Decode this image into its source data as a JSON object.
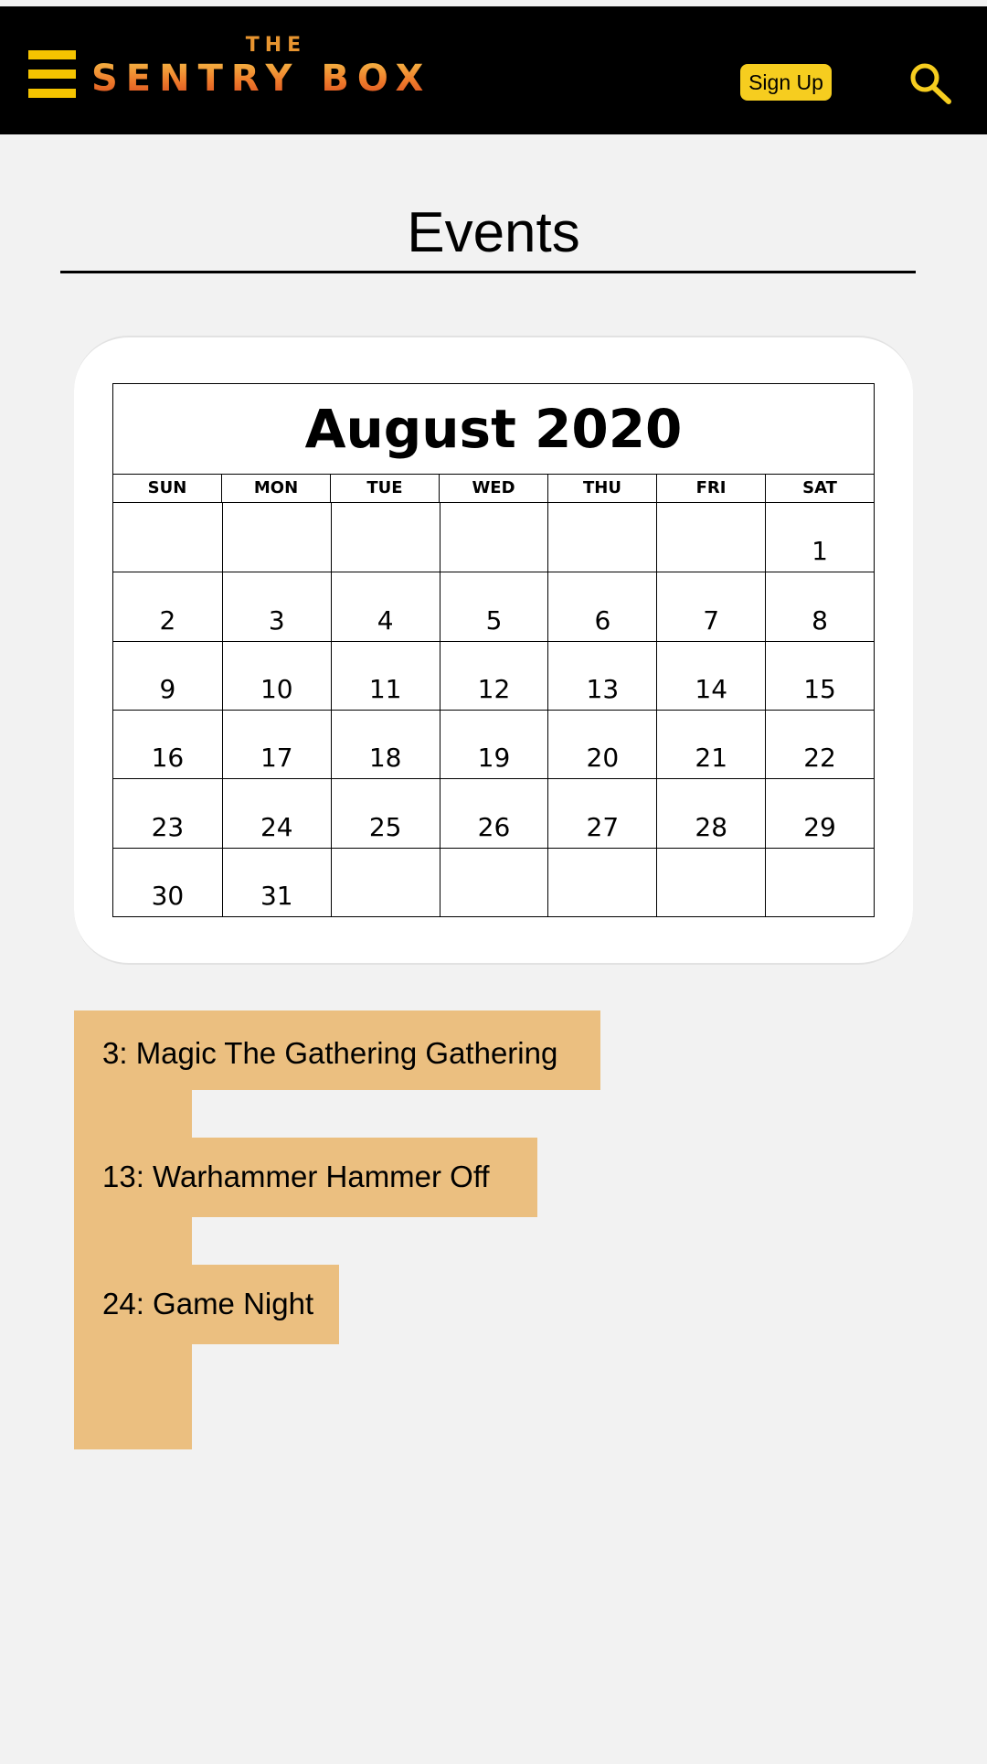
{
  "header": {
    "logo_small": "THE",
    "logo_main": "SENTRY BOX",
    "signup_label": "Sign Up"
  },
  "page": {
    "title": "Events"
  },
  "calendar": {
    "month_title": "August 2020",
    "weekdays": [
      "SUN",
      "MON",
      "TUE",
      "WED",
      "THU",
      "FRI",
      "SAT"
    ],
    "weeks": [
      [
        "",
        "",
        "",
        "",
        "",
        "",
        "1"
      ],
      [
        "2",
        "3",
        "4",
        "5",
        "6",
        "7",
        "8"
      ],
      [
        "9",
        "10",
        "11",
        "12",
        "13",
        "14",
        "15"
      ],
      [
        "16",
        "17",
        "18",
        "19",
        "20",
        "21",
        "22"
      ],
      [
        "23",
        "24",
        "25",
        "26",
        "27",
        "28",
        "29"
      ],
      [
        "30",
        "31",
        "",
        "",
        "",
        "",
        ""
      ]
    ]
  },
  "events": [
    {
      "label": "3: Magic The Gathering Gathering"
    },
    {
      "label": "13: Warhammer Hammer Off"
    },
    {
      "label": "24: Game Night"
    }
  ],
  "colors": {
    "header_bg": "#000000",
    "accent_yellow": "#f6cd1f",
    "page_bg": "#f2f2f2",
    "events_bg": "#ebbf80"
  }
}
